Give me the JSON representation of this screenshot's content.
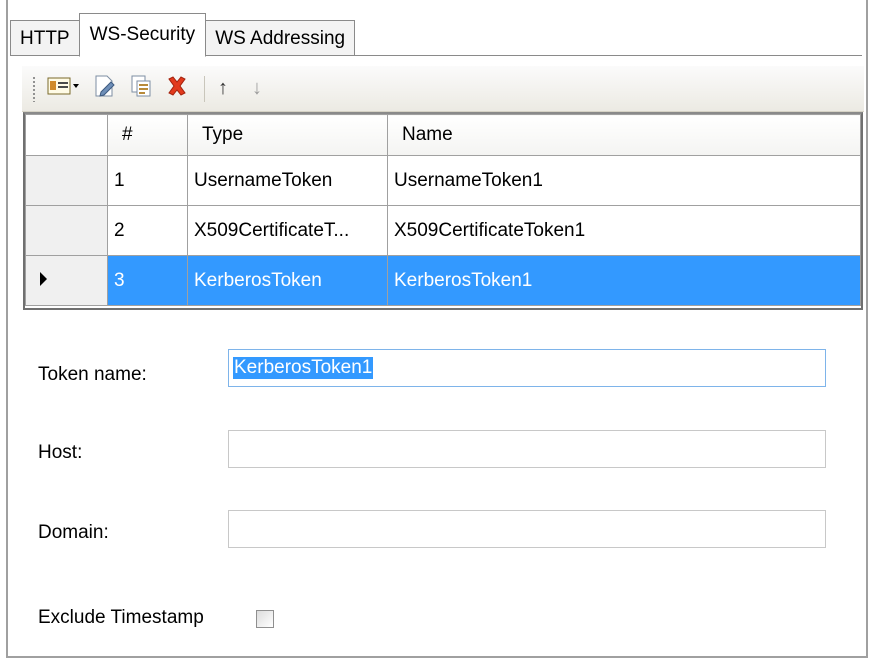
{
  "tabs": [
    {
      "label": "HTTP",
      "active": false
    },
    {
      "label": "WS-Security",
      "active": true
    },
    {
      "label": "WS Addressing",
      "active": false
    }
  ],
  "toolbar": {
    "items": [
      "add-token-dropdown-icon",
      "edit-icon",
      "copy-icon",
      "delete-icon",
      "move-up-icon",
      "move-down-icon"
    ],
    "delete_color": "#e23a1d"
  },
  "grid": {
    "columns": [
      "#",
      "Type",
      "Name"
    ],
    "rows": [
      {
        "num": "1",
        "type": "UsernameToken",
        "name": "UsernameToken1",
        "selected": false
      },
      {
        "num": "2",
        "type": "X509CertificateT...",
        "name": "X509CertificateToken1",
        "selected": false
      },
      {
        "num": "3",
        "type": "KerberosToken",
        "name": "KerberosToken1",
        "selected": true
      }
    ],
    "selection_color": "#3399ff"
  },
  "form": {
    "token_name_label": "Token name:",
    "token_name_value": "KerberosToken1",
    "host_label": "Host:",
    "host_value": "",
    "domain_label": "Domain:",
    "domain_value": "",
    "exclude_timestamp_label": "Exclude Timestamp",
    "exclude_timestamp_checked": false
  }
}
